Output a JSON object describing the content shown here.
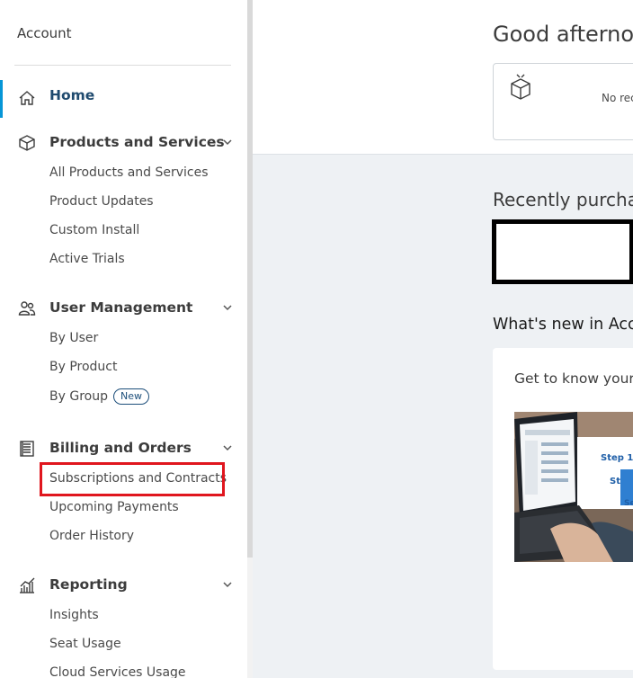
{
  "sidebar": {
    "title": "Account",
    "home": {
      "label": "Home",
      "icon": "home-icon"
    },
    "sections": [
      {
        "label": "Products and Services",
        "icon": "box-icon",
        "items": [
          "All Products and Services",
          "Product Updates",
          "Custom Install",
          "Active Trials"
        ]
      },
      {
        "label": "User Management",
        "icon": "users-icon",
        "items": [
          "By User",
          "By Product",
          "By Group"
        ],
        "badge": "New"
      },
      {
        "label": "Billing and Orders",
        "icon": "ledger-icon",
        "items": [
          "Subscriptions and Contracts",
          "Upcoming Payments",
          "Order History"
        ],
        "highlighted": "Subscriptions and Contracts"
      },
      {
        "label": "Reporting",
        "icon": "chart-icon",
        "items": [
          "Insights",
          "Seat Usage",
          "Cloud Services Usage"
        ]
      }
    ],
    "accent_color": "#0696d7",
    "highlight_color": "#e0161e"
  },
  "main": {
    "greeting": "Good afternoo",
    "top_card": {
      "text": "No rec",
      "icon": "package-icon"
    },
    "recent_title": "Recently purchas",
    "whats_new_title": "What's new in Acco",
    "news_card": {
      "text": "Get to know your",
      "image_lines": [
        "Step 1:",
        "Step",
        "Se"
      ]
    }
  }
}
